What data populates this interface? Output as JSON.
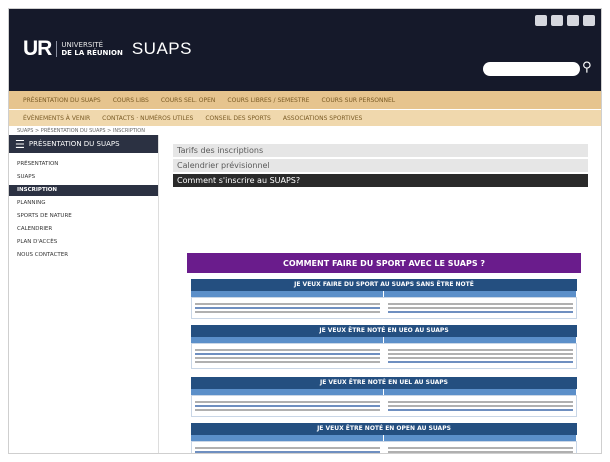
{
  "header": {
    "logo_ur": "UR",
    "logo_line1": "UNIVERSITÉ",
    "logo_line2": "DE LA RÉUNION",
    "logo_suaps": "SUAPS",
    "search_icon": "search-icon",
    "social_icons": [
      "social-icon",
      "social-icon",
      "social-icon",
      "social-icon"
    ]
  },
  "nav": {
    "primary": [
      "PRÉSENTATION DU SUAPS",
      "COURS LIBS",
      "COURS SEL. OPEN",
      "COURS LIBRES / SEMESTRE",
      "COURS SUR PERSONNEL"
    ],
    "secondary": [
      "ÉVÈNEMENTS À VENIR",
      "CONTACTS · NUMÉROS UTILES",
      "CONSEIL DES SPORTS",
      "ASSOCIATIONS SPORTIVES"
    ]
  },
  "breadcrumb": "SUAPS > PRÉSENTATION DU SUAPS > INSCRIPTION",
  "sidebar": {
    "title": "PRÉSENTATION DU SUAPS",
    "items": [
      "PRÉSENTATION",
      "SUAPS",
      "INSCRIPTION",
      "PLANNING",
      "SPORTS DE NATURE",
      "CALENDRIER",
      "PLAN D'ACCÈS",
      "NOUS CONTACTER"
    ]
  },
  "main": {
    "bars": [
      "Tarifs des inscriptions",
      "Calendrier prévisionnel",
      "Comment s'inscrire au SUAPS?"
    ],
    "banner": "COMMENT FAIRE DU SPORT AVEC LE SUAPS ?",
    "sections": [
      "JE VEUX FAIRE DU SPORT AU SUAPS SANS ÊTRE NOTÉ",
      "JE VEUX ÊTRE NOTÉ EN UEO AU SUAPS",
      "JE VEUX ÊTRE NOTÉ EN UEL AU SUAPS",
      "JE VEUX ÊTRE NOTÉ EN OPEN AU SUAPS"
    ]
  }
}
